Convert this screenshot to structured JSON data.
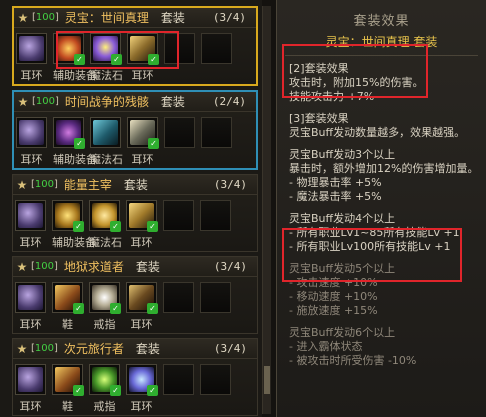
{
  "sets": [
    {
      "level": "100",
      "name": "灵宝：世间真理",
      "type": "套装",
      "count": "(3/4)",
      "slot_labels": [
        "耳环",
        "辅助装备",
        "魔法石",
        "耳环"
      ]
    },
    {
      "level": "100",
      "name": "时间战争的残骸",
      "type": "套装",
      "count": "(2/4)",
      "slot_labels": [
        "耳环",
        "辅助装备",
        "魔法石",
        "耳环"
      ]
    },
    {
      "level": "100",
      "name": "能量主宰",
      "type": "套装",
      "count": "(3/4)",
      "slot_labels": [
        "耳环",
        "辅助装备",
        "魔法石",
        "耳环"
      ]
    },
    {
      "level": "100",
      "name": "地狱求道者",
      "type": "套装",
      "count": "(3/4)",
      "slot_labels": [
        "耳环",
        "鞋",
        "戒指",
        "耳环"
      ]
    },
    {
      "level": "100",
      "name": "次元旅行者",
      "type": "套装",
      "count": "(3/4)",
      "slot_labels": [
        "耳环",
        "鞋",
        "戒指",
        "耳环"
      ]
    }
  ],
  "panel": {
    "title": "套装效果",
    "subtitle": "灵宝：世间真理  套装",
    "effect2_head": "[2]套装效果",
    "effect2_l1": "攻击时，附加15%的伤害。",
    "effect2_l2": "技能攻击力 +7%",
    "effect3_head": "[3]套装效果",
    "effect3_intro": "灵宝Buff发动数量越多，效果越强。",
    "buff3_head": "灵宝Buff发动3个以上",
    "buff3_l1": "暴击时，额外增加12%的伤害增加量。",
    "buff3_l2": "- 物理暴击率 +5%",
    "buff3_l3": "- 魔法暴击率 +5%",
    "buff4_head": "灵宝Buff发动4个以上",
    "buff4_l1": "- 所有职业Lv1~85所有技能Lv +1",
    "buff4_l2": "- 所有职业Lv100所有技能Lv +1",
    "buff5_head": "灵宝Buff发动5个以上",
    "buff5_l1": "- 攻击速度 +10%",
    "buff5_l2": "- 移动速度 +10%",
    "buff5_l3": "- 施放速度 +15%",
    "buff6_head": "灵宝Buff发动6个以上",
    "buff6_l1": "- 进入霸体状态",
    "buff6_l2": "- 被攻击时所受伤害 -10%"
  }
}
